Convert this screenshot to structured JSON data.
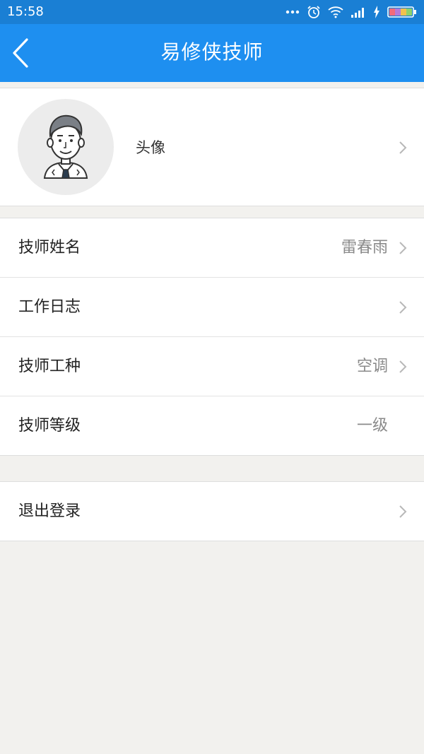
{
  "status_bar": {
    "time": "15:58",
    "icons": [
      "more-dots-icon",
      "alarm-icon",
      "wifi-icon",
      "signal-icon",
      "charging-icon",
      "battery-icon"
    ]
  },
  "header": {
    "title": "易修侠技师",
    "background": "#1e8ff0",
    "status_background": "#1a7fd4",
    "back_icon": "chevron-left-icon"
  },
  "avatar": {
    "label": "头像",
    "icon": "man-in-suit-avatar"
  },
  "rows": [
    {
      "label": "技师姓名",
      "value": "雷春雨",
      "chevron": true
    },
    {
      "label": "工作日志",
      "value": "",
      "chevron": true
    },
    {
      "label": "技师工种",
      "value": "空调",
      "chevron": true
    },
    {
      "label": "技师等级",
      "value": "一级",
      "chevron": false
    }
  ],
  "logout": {
    "label": "退出登录",
    "chevron": true
  },
  "colors": {
    "page_background": "#f2f1ee",
    "card_background": "#ffffff",
    "label_text": "#222222",
    "value_text": "#8a8a8a",
    "chevron": "#b8b8b8"
  }
}
